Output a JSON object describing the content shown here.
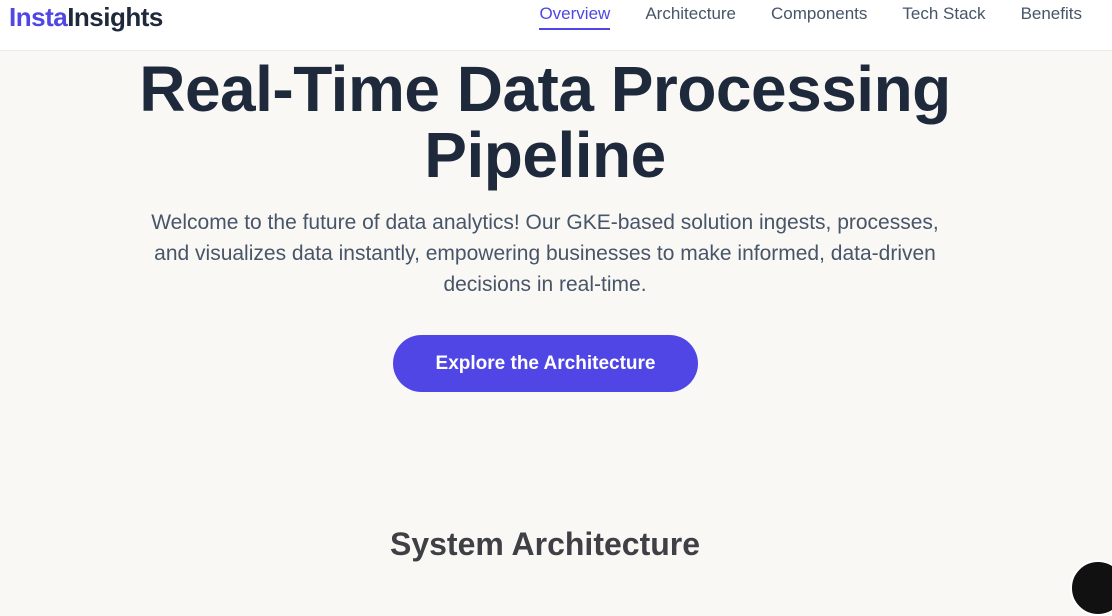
{
  "brand": {
    "part1": "Insta",
    "part2": "Insights"
  },
  "nav": {
    "items": [
      {
        "label": "Overview",
        "active": true
      },
      {
        "label": "Architecture"
      },
      {
        "label": "Components"
      },
      {
        "label": "Tech Stack"
      },
      {
        "label": "Benefits"
      }
    ]
  },
  "hero": {
    "title_line1": "Real-Time Data Processing",
    "title_line2": "Pipeline",
    "description": "Welcome to the future of data analytics! Our GKE-based solution ingests, processes, and visualizes data instantly, empowering businesses to make informed, data-driven decisions in real-time.",
    "cta_label": "Explore the Architecture"
  },
  "section": {
    "title": "System Architecture"
  },
  "colors": {
    "accent": "#4f46e5",
    "text": "#1e293b",
    "background": "#faf8f5"
  }
}
